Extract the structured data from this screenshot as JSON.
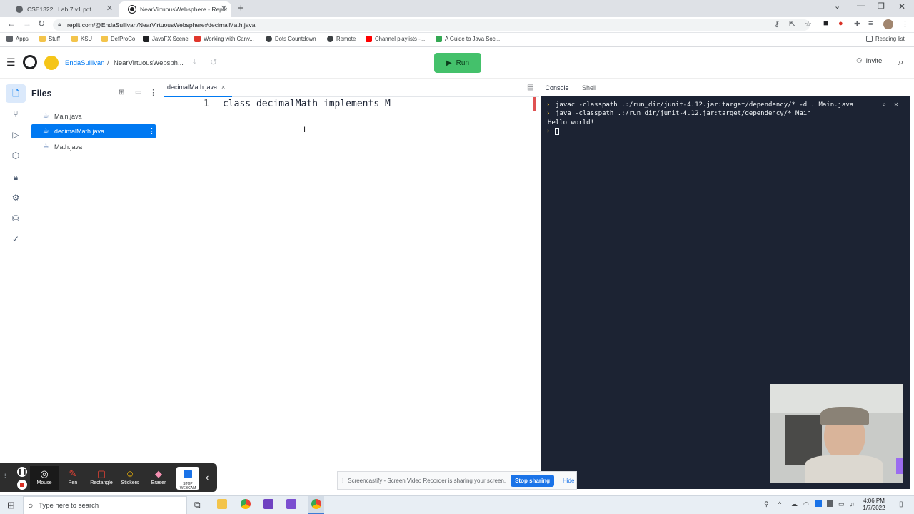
{
  "browser": {
    "tabs": [
      {
        "title": "CSE1322L Lab 7 v1.pdf",
        "active": false
      },
      {
        "title": "NearVirtuousWebsphere - Replit",
        "active": true
      }
    ],
    "new_tab_glyph": "+",
    "url": "replit.com/@EndaSullivan/NearVirtuousWebsphere#decimalMath.java",
    "bookmarks": [
      {
        "label": "Apps",
        "icon": "apps-grid-icon"
      },
      {
        "label": "Stuff",
        "icon": "folder-icon"
      },
      {
        "label": "KSU",
        "icon": "folder-icon"
      },
      {
        "label": "DefProCo",
        "icon": "folder-icon"
      },
      {
        "label": "JavaFX Scene",
        "icon": "javafx-icon"
      },
      {
        "label": "Working with Canv...",
        "icon": "canvas-icon"
      },
      {
        "label": "Dots Countdown",
        "icon": "dots-icon"
      },
      {
        "label": "Remote",
        "icon": "remote-icon"
      },
      {
        "label": "Channel playlists -...",
        "icon": "youtube-icon"
      },
      {
        "label": "A Guide to Java Soc...",
        "icon": "guide-icon"
      }
    ],
    "reading_list": "Reading list"
  },
  "replit": {
    "user": "EndaSullivan",
    "separator": "/",
    "project": "NearVirtuousWebsph...",
    "run_label": "Run",
    "invite_label": "Invite",
    "files_title": "Files",
    "files": [
      {
        "name": "Main.java",
        "selected": false
      },
      {
        "name": "decimalMath.java",
        "selected": true
      },
      {
        "name": "Math.java",
        "selected": false
      }
    ],
    "editor_tab": "decimalMath.java",
    "editor_tab_close": "×",
    "code_lines": [
      {
        "num": "1",
        "text": "class decimalMath implements M"
      }
    ],
    "console_tab": "Console",
    "shell_tab": "Shell",
    "console_lines": [
      "javac -classpath .:/run_dir/junit-4.12.jar:target/dependency/* -d . Main.java",
      "java -classpath .:/run_dir/junit-4.12.jar:target/dependency/* Main",
      "Hello world!"
    ]
  },
  "recorder": {
    "tools": [
      {
        "label": "Mouse",
        "icon": "mouse-icon"
      },
      {
        "label": "Pen",
        "icon": "pen-icon"
      },
      {
        "label": "Rectangle",
        "icon": "rectangle-icon"
      },
      {
        "label": "Stickers",
        "icon": "sticker-icon"
      },
      {
        "label": "Eraser",
        "icon": "eraser-icon"
      }
    ],
    "webcam_label": "STOP WEBCAM",
    "share_text": "Screencastify - Screen Video Recorder is sharing your screen.",
    "stop_sharing": "Stop sharing",
    "hide": "Hide"
  },
  "taskbar": {
    "search_placeholder": "Type here to search",
    "time": "4:06 PM",
    "date": "1/7/2022"
  },
  "colors": {
    "accent": "#0079f2",
    "run": "#44c16b",
    "console_bg": "#1c2333"
  }
}
